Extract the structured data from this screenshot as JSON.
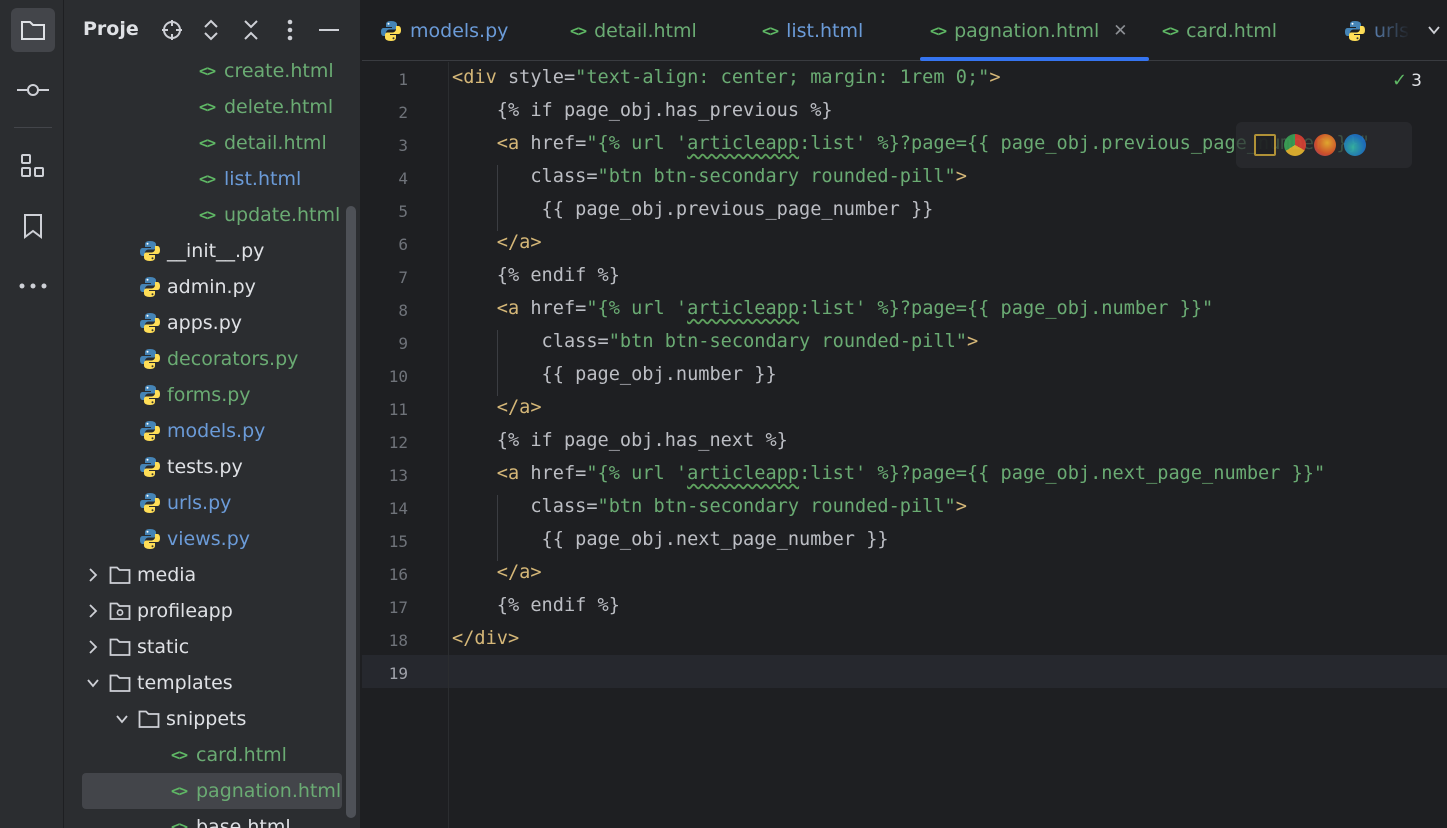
{
  "project_panel": {
    "title": "Proje",
    "tree": [
      {
        "label": "create.html",
        "kind": "html",
        "color": "green"
      },
      {
        "label": "delete.html",
        "kind": "html",
        "color": "green"
      },
      {
        "label": "detail.html",
        "kind": "html",
        "color": "green"
      },
      {
        "label": "list.html",
        "kind": "html",
        "color": "blue"
      },
      {
        "label": "update.html",
        "kind": "html",
        "color": "green"
      },
      {
        "label": "__init__.py",
        "kind": "py",
        "color": "white"
      },
      {
        "label": "admin.py",
        "kind": "py",
        "color": "white"
      },
      {
        "label": "apps.py",
        "kind": "py",
        "color": "white"
      },
      {
        "label": "decorators.py",
        "kind": "py",
        "color": "green"
      },
      {
        "label": "forms.py",
        "kind": "py",
        "color": "green"
      },
      {
        "label": "models.py",
        "kind": "py",
        "color": "blue"
      },
      {
        "label": "tests.py",
        "kind": "py",
        "color": "white"
      },
      {
        "label": "urls.py",
        "kind": "py",
        "color": "blue"
      },
      {
        "label": "views.py",
        "kind": "py",
        "color": "blue"
      },
      {
        "label": "media",
        "kind": "folder",
        "color": "white",
        "expanded": false
      },
      {
        "label": "profileapp",
        "kind": "module",
        "color": "white",
        "expanded": false
      },
      {
        "label": "static",
        "kind": "folder",
        "color": "white",
        "expanded": false
      },
      {
        "label": "templates",
        "kind": "folder",
        "color": "white",
        "expanded": true
      },
      {
        "label": "snippets",
        "kind": "folder",
        "color": "white",
        "expanded": true
      },
      {
        "label": "card.html",
        "kind": "html",
        "color": "green"
      },
      {
        "label": "pagnation.html",
        "kind": "html",
        "color": "green",
        "selected": true
      },
      {
        "label": "base.html",
        "kind": "html",
        "color": "white"
      }
    ]
  },
  "tabs": [
    {
      "label": "models.py",
      "kind": "py",
      "color": "blue"
    },
    {
      "label": "detail.html",
      "kind": "html",
      "color": "green"
    },
    {
      "label": "list.html",
      "kind": "html",
      "color": "blue"
    },
    {
      "label": "pagnation.html",
      "kind": "html",
      "color": "green",
      "active": true
    },
    {
      "label": "card.html",
      "kind": "html",
      "color": "green"
    },
    {
      "label": "urls",
      "kind": "py",
      "color": "blue"
    }
  ],
  "editor": {
    "inspection_count": "3",
    "current_line": 19,
    "lines": [
      {
        "n": "1",
        "tokens": [
          [
            "tag",
            "<div "
          ],
          [
            "attr",
            "style="
          ],
          [
            "str",
            "\"text-align: center; margin: 1rem 0;\""
          ],
          [
            "tag",
            ">"
          ]
        ]
      },
      {
        "n": "2",
        "tokens": [
          [
            "tpl",
            "    {% if page_obj.has_previous %}"
          ]
        ]
      },
      {
        "n": "3",
        "tokens": [
          [
            "tag",
            "    <a "
          ],
          [
            "attr",
            "href="
          ],
          [
            "str",
            "\"{% url '"
          ],
          [
            "squig",
            "articleapp"
          ],
          [
            "str",
            ":list' %}?page={{ page_obj.previous_page_number }}\""
          ]
        ]
      },
      {
        "n": "4",
        "tokens": [
          [
            "attr",
            "       class="
          ],
          [
            "str",
            "\"btn btn-secondary rounded-pill\""
          ],
          [
            "tag",
            ">"
          ]
        ]
      },
      {
        "n": "5",
        "tokens": [
          [
            "tpl",
            "        {{ page_obj.previous_page_number }}"
          ]
        ]
      },
      {
        "n": "6",
        "tokens": [
          [
            "tag",
            "    </a>"
          ]
        ]
      },
      {
        "n": "7",
        "tokens": [
          [
            "tpl",
            "    {% endif %}"
          ]
        ]
      },
      {
        "n": "8",
        "tokens": [
          [
            "tag",
            "    <a "
          ],
          [
            "attr",
            "href="
          ],
          [
            "str",
            "\"{% url '"
          ],
          [
            "squig",
            "articleapp"
          ],
          [
            "str",
            ":list' %}?page={{ page_obj.number }}\""
          ]
        ]
      },
      {
        "n": "9",
        "tokens": [
          [
            "attr",
            "        class="
          ],
          [
            "str",
            "\"btn btn-secondary rounded-pill\""
          ],
          [
            "tag",
            ">"
          ]
        ]
      },
      {
        "n": "10",
        "tokens": [
          [
            "tpl",
            "        {{ page_obj.number }}"
          ]
        ]
      },
      {
        "n": "11",
        "tokens": [
          [
            "tag",
            "    </a>"
          ]
        ]
      },
      {
        "n": "12",
        "tokens": [
          [
            "tpl",
            "    {% if page_obj.has_next %}"
          ]
        ]
      },
      {
        "n": "13",
        "tokens": [
          [
            "tag",
            "    <a "
          ],
          [
            "attr",
            "href="
          ],
          [
            "str",
            "\"{% url '"
          ],
          [
            "squig",
            "articleapp"
          ],
          [
            "str",
            ":list' %}?page={{ page_obj.next_page_number }}\""
          ]
        ]
      },
      {
        "n": "14",
        "tokens": [
          [
            "attr",
            "       class="
          ],
          [
            "str",
            "\"btn btn-secondary rounded-pill\""
          ],
          [
            "tag",
            ">"
          ]
        ]
      },
      {
        "n": "15",
        "tokens": [
          [
            "tpl",
            "        {{ page_obj.next_page_number }}"
          ]
        ]
      },
      {
        "n": "16",
        "tokens": [
          [
            "tag",
            "    </a>"
          ]
        ]
      },
      {
        "n": "17",
        "tokens": [
          [
            "tpl",
            "    {% endif %}"
          ]
        ]
      },
      {
        "n": "18",
        "tokens": [
          [
            "tag",
            "</div>"
          ]
        ]
      },
      {
        "n": "19",
        "tokens": []
      }
    ]
  },
  "colors": {
    "accent": "#3574f0",
    "html_green": "#6aab73",
    "vcs_blue": "#6b9bd8",
    "tag_yellow": "#d5b778"
  },
  "icons": {
    "activity": [
      "folder-icon",
      "commit-icon",
      "structure-icon",
      "bookmark-icon",
      "more-icon"
    ],
    "header": [
      "locate-icon",
      "expand-collapse-icon",
      "collapse-all-icon",
      "options-icon",
      "hide-icon"
    ],
    "browsers": [
      "intellij-browser-icon",
      "chrome-icon",
      "firefox-icon",
      "edge-icon"
    ]
  }
}
